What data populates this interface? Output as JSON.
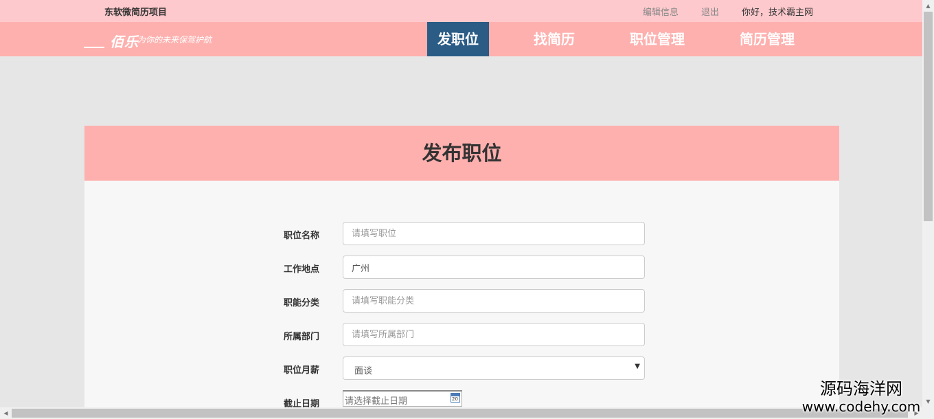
{
  "topbar": {
    "project_name": "东软微简历项目",
    "edit_info": "编辑信息",
    "logout": "退出",
    "greeting": "你好，技术霸主网"
  },
  "logo": {
    "brand": "佰乐",
    "slogan": "为你的未来保驾护航"
  },
  "nav": {
    "items": [
      {
        "label": "发职位"
      },
      {
        "label": "找简历"
      },
      {
        "label": "职位管理"
      },
      {
        "label": "简历管理"
      }
    ],
    "active_color": "#2b5c85"
  },
  "panel": {
    "title": "发布职位"
  },
  "form": {
    "job_name": {
      "label": "职位名称",
      "placeholder": "请填写职位",
      "value": ""
    },
    "location": {
      "label": "工作地点",
      "placeholder": "",
      "value": "广州"
    },
    "category": {
      "label": "职能分类",
      "placeholder": "请填写职能分类",
      "value": ""
    },
    "department": {
      "label": "所属部门",
      "placeholder": "请填写所属部门",
      "value": ""
    },
    "salary": {
      "label": "职位月薪",
      "selected": "面谈"
    },
    "deadline": {
      "label": "截止日期",
      "placeholder": "请选择截止日期",
      "calendar_day": "20"
    }
  },
  "watermark": {
    "line1": "源码海洋网",
    "line2": "www.codehy.com"
  },
  "colors": {
    "topbar": "#fec9cd",
    "navbar": "#feb0ae",
    "page_bg": "#e6e6e6"
  }
}
